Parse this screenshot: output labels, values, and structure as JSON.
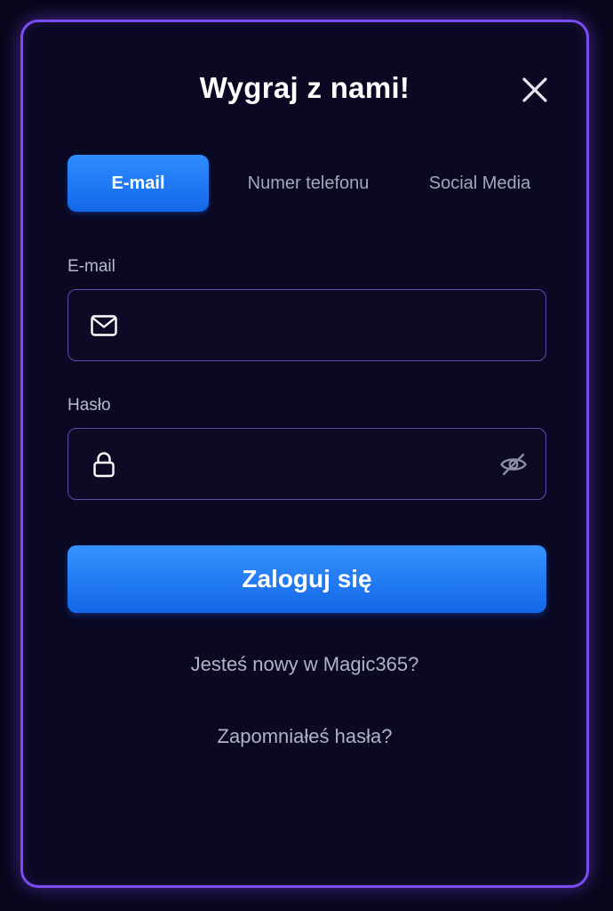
{
  "modal": {
    "title": "Wygraj z nami!",
    "close_icon": "close-icon"
  },
  "tabs": [
    {
      "label": "E-mail",
      "active": true
    },
    {
      "label": "Numer telefonu",
      "active": false
    },
    {
      "label": "Social Media",
      "active": false
    }
  ],
  "email_field": {
    "label": "E-mail",
    "value": "",
    "placeholder": "",
    "icon": "envelope-icon"
  },
  "password_field": {
    "label": "Hasło",
    "value": "",
    "placeholder": "",
    "icon": "lock-icon",
    "toggle_icon": "eye-off-icon"
  },
  "login_button": {
    "label": "Zaloguj się"
  },
  "links": {
    "register": "Jesteś nowy w Magic365?",
    "forgot_password": "Zapomniałeś hasła?"
  },
  "colors": {
    "accent": "#1f7bff",
    "border": "#7b4df0",
    "background": "#0a0822"
  }
}
